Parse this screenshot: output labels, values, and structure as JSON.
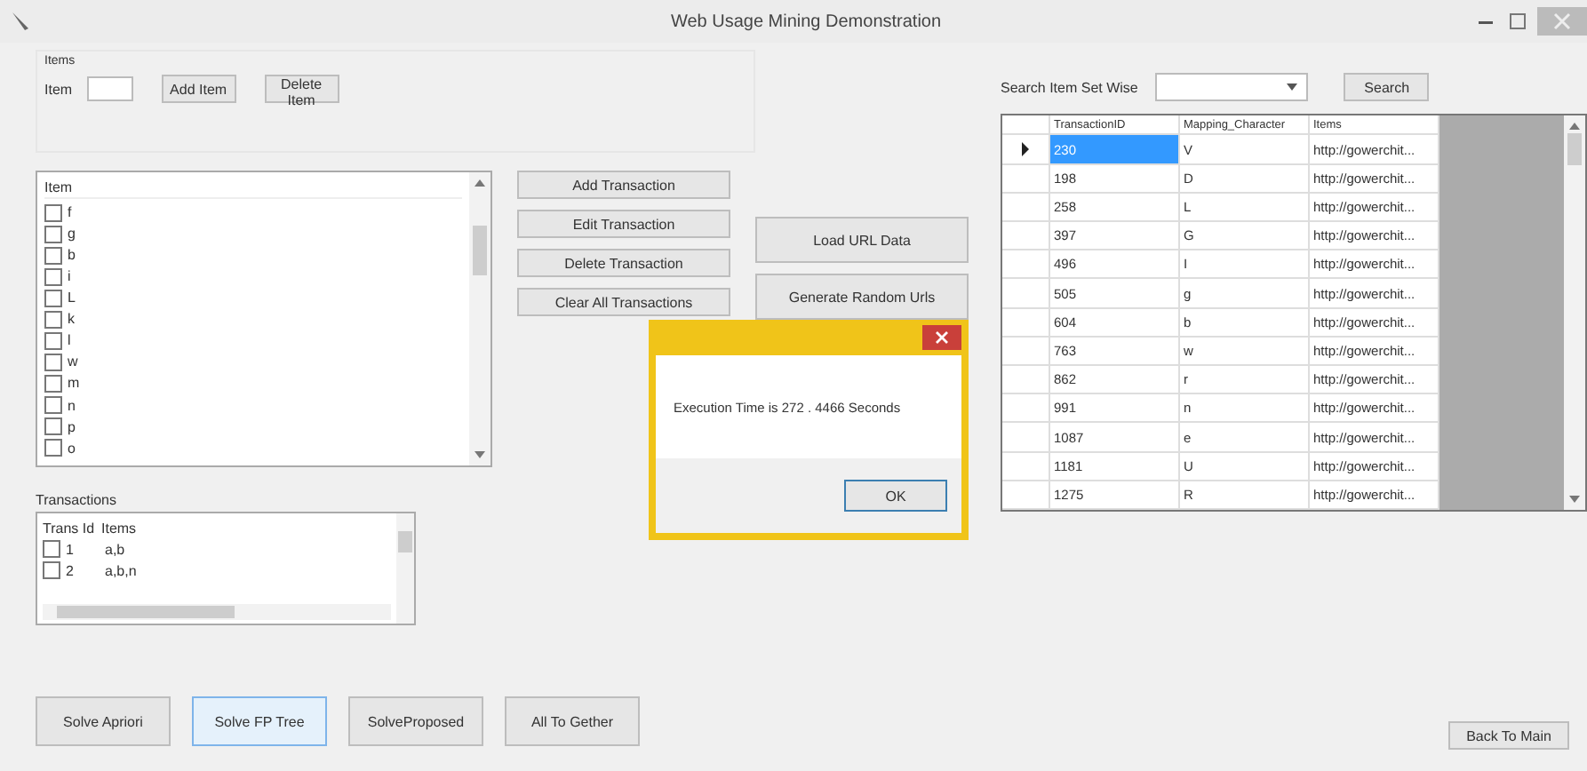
{
  "window": {
    "title": "Web Usage Mining Demonstration"
  },
  "items_group": {
    "title": "Items",
    "label": "Item",
    "buttons": [
      "Add Item",
      "Delete Item"
    ]
  },
  "item_list": {
    "header": "Item",
    "items": [
      {
        "label": "f",
        "checked": false
      },
      {
        "label": "g",
        "checked": false
      },
      {
        "label": "b",
        "checked": false
      },
      {
        "label": "i",
        "checked": false
      },
      {
        "label": "L",
        "checked": false
      },
      {
        "label": "k",
        "checked": false
      },
      {
        "label": "l",
        "checked": false
      },
      {
        "label": "w",
        "checked": false
      },
      {
        "label": "m",
        "checked": false
      },
      {
        "label": "n",
        "checked": false
      },
      {
        "label": "p",
        "checked": false
      },
      {
        "label": "o",
        "checked": false
      }
    ]
  },
  "transaction_buttons": [
    "Add Transaction",
    "Edit Transaction",
    "Delete Transaction",
    "Clear All Transactions"
  ],
  "data_buttons": [
    "Load URL Data",
    "Generate Random Urls"
  ],
  "transactions": {
    "title": "Transactions",
    "columns": [
      "Trans Id",
      "Items"
    ],
    "rows": [
      {
        "id": "1",
        "items": "a,b",
        "checked": false
      },
      {
        "id": "2",
        "items": "a,b,n",
        "checked": false
      }
    ]
  },
  "search": {
    "label": "Search Item Set Wise",
    "button": "Search"
  },
  "grid": {
    "columns": [
      "TransactionID",
      "Mapping_Character",
      "Items"
    ],
    "rows": [
      {
        "cells": [
          "230",
          "V",
          "http://gowerchit..."
        ],
        "selected": true
      },
      {
        "cells": [
          "198",
          "D",
          "http://gowerchit..."
        ],
        "selected": false
      },
      {
        "cells": [
          "258",
          "L",
          "http://gowerchit..."
        ],
        "selected": false
      },
      {
        "cells": [
          "397",
          "G",
          "http://gowerchit..."
        ],
        "selected": false
      },
      {
        "cells": [
          "496",
          "I",
          "http://gowerchit..."
        ],
        "selected": false
      },
      {
        "cells": [
          "505",
          "g",
          "http://gowerchit..."
        ],
        "selected": false
      },
      {
        "cells": [
          "604",
          "b",
          "http://gowerchit..."
        ],
        "selected": false
      },
      {
        "cells": [
          "763",
          "w",
          "http://gowerchit..."
        ],
        "selected": false
      },
      {
        "cells": [
          "862",
          "r",
          "http://gowerchit..."
        ],
        "selected": false
      },
      {
        "cells": [
          "991",
          "n",
          "http://gowerchit..."
        ],
        "selected": false
      },
      {
        "cells": [
          "1087",
          "e",
          "http://gowerchit..."
        ],
        "selected": false
      },
      {
        "cells": [
          "1181",
          "U",
          "http://gowerchit..."
        ],
        "selected": false
      },
      {
        "cells": [
          "1275",
          "R",
          "http://gowerchit..."
        ],
        "selected": false
      }
    ]
  },
  "bottom_buttons": [
    {
      "label": "Solve Apriori",
      "selected": false
    },
    {
      "label": "Solve FP Tree",
      "selected": true
    },
    {
      "label": "SolveProposed",
      "selected": false
    },
    {
      "label": "All To Gether",
      "selected": false
    }
  ],
  "back_button": "Back To Main",
  "dialog": {
    "message": "Execution Time is 272 . 4466 Seconds",
    "button": "OK"
  }
}
